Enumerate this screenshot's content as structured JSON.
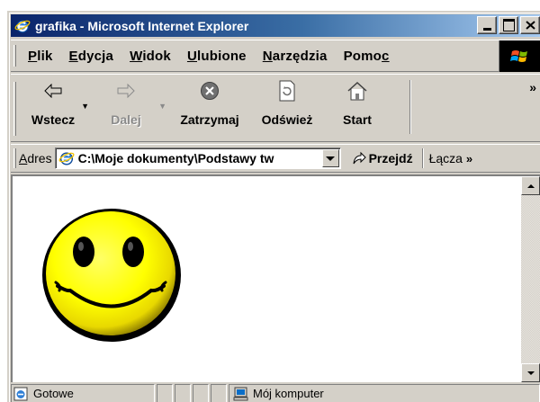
{
  "window": {
    "title": "grafika - Microsoft Internet Explorer",
    "title_icon": "ie-logo-icon"
  },
  "menubar": {
    "items": [
      {
        "label": "Plik",
        "accel_index": 0
      },
      {
        "label": "Edycja",
        "accel_index": 0
      },
      {
        "label": "Widok",
        "accel_index": 0
      },
      {
        "label": "Ulubione",
        "accel_index": 0
      },
      {
        "label": "Narzędzia",
        "accel_index": 0
      },
      {
        "label": "Pomoc",
        "accel_index": 4
      }
    ]
  },
  "toolbar": {
    "back_label": "Wstecz",
    "forward_label": "Dalej",
    "stop_label": "Zatrzymaj",
    "refresh_label": "Odśwież",
    "home_label": "Start",
    "overflow": "»"
  },
  "addressbar": {
    "label": "Adres",
    "value": "C:\\Moje dokumenty\\Podstawy tw",
    "go_label": "Przejdź",
    "links_label": "Łącza",
    "links_overflow": "»"
  },
  "content": {
    "image": "smiley-face",
    "colors": {
      "face": "#ffff00",
      "outline": "#000000",
      "eyes": "#000000"
    }
  },
  "statusbar": {
    "status_text": "Gotowe",
    "zone_text": "Mój komputer"
  }
}
